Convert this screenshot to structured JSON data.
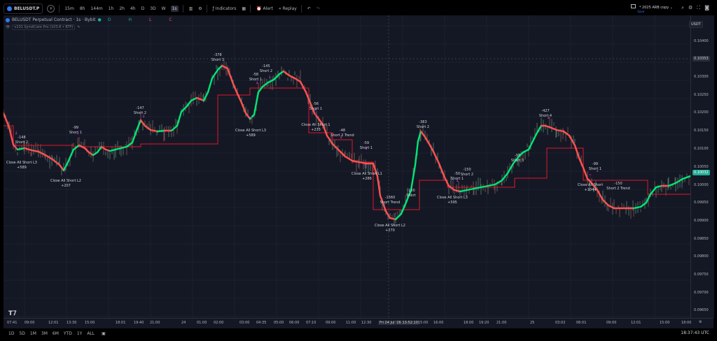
{
  "toolbar": {
    "symbol": "BELUSDT.P",
    "timeframes": [
      "15m",
      "8h",
      "144m",
      "1h",
      "2h",
      "4h",
      "D",
      "3D",
      "W",
      "1s"
    ],
    "active_timeframe": "1s",
    "indicators_label": "Indicators",
    "alert_label": "Alert",
    "replay_label": "Replay",
    "layout_name": "* 2025 ARB copy",
    "layout_status": "Save"
  },
  "legend": {
    "title": "BELUSDT Perpetual Contract · 1s · Bybit",
    "o_label": "O",
    "h_label": "H",
    "l_label": "L",
    "c_label": "C",
    "indicator": "v131 SyndiCate Pro (103.8 • RTF)"
  },
  "price_scale": {
    "currency": "USDT",
    "ticks": [
      "0.10400",
      "0.10350",
      "0.10300",
      "0.10250",
      "0.10200",
      "0.10150",
      "0.10100",
      "0.10050",
      "0.10000",
      "0.09950",
      "0.09900",
      "0.09850",
      "0.09800",
      "0.09750",
      "0.09700",
      "0.09650"
    ],
    "crosshair_price": "0.10353",
    "last_price": "0.10032"
  },
  "time_scale": {
    "ticks": [
      "07:41",
      "09:00",
      "12:01",
      "13:30",
      "15:00",
      "18:01",
      "19:40",
      "21:00",
      "24",
      "01:00",
      "02:00",
      "03:00",
      "04:35",
      "05:00",
      "06:00",
      "07:10",
      "09:00",
      "11:00",
      "12:30",
      "Fri 24 Jul '26  13:52:10",
      "15:00",
      "16:00",
      "18:00",
      "19:20",
      "21:00",
      "25",
      "03:02",
      "06:01",
      "09:00",
      "12:01",
      "15:00",
      "18:00"
    ],
    "highlight": "Fri 24 Jul '26  13:52:10"
  },
  "bottom": {
    "ranges": [
      "1D",
      "5D",
      "1M",
      "3M",
      "6M",
      "YTD",
      "1Y",
      "ALL"
    ],
    "clock": "18:37:43 UTC"
  },
  "annotations": [
    {
      "text": "-148",
      "sub": "Short 2"
    },
    {
      "text": "Close All Short L3",
      "sub": "+589"
    },
    {
      "text": "-99",
      "sub": "Short 1"
    },
    {
      "text": "Close All Short L2",
      "sub": "+207"
    },
    {
      "text": "-147",
      "sub": "Short 2"
    },
    {
      "text": "-378",
      "sub": "Short 3"
    },
    {
      "text": "-58",
      "sub": "Short 1"
    },
    {
      "text": "-145",
      "sub": "Short 2"
    },
    {
      "text": "Close All Short L3",
      "sub": "+589"
    },
    {
      "text": "-56",
      "sub": "Short 1"
    },
    {
      "text": "Close All Short 1",
      "sub": "+233"
    },
    {
      "text": "-48",
      "sub": "Short 2 Trend"
    },
    {
      "text": "-59",
      "sub": "Short 1"
    },
    {
      "text": "Close All Short L1",
      "sub": "+286"
    },
    {
      "text": "-1560",
      "sub": "Short Trend"
    },
    {
      "text": "-150",
      "sub": "Short"
    },
    {
      "text": "Close All Short L2",
      "sub": "+270"
    },
    {
      "text": "-383",
      "sub": "Short 2"
    },
    {
      "text": "-50",
      "sub": "Short 1"
    },
    {
      "text": "-150",
      "sub": "Short 2"
    },
    {
      "text": "Close All Short L3",
      "sub": "+595"
    },
    {
      "text": "-97",
      "sub": "Short 3"
    },
    {
      "text": "-427",
      "sub": "Short 4"
    },
    {
      "text": "-99",
      "sub": "Short 1"
    },
    {
      "text": "Close All Short",
      "sub": "+1044"
    },
    {
      "text": "-150",
      "sub": "Short 2 Trend"
    }
  ],
  "colors": {
    "background": "#141824",
    "up": "#00e676",
    "down": "#ff5252",
    "level": "#e0162b",
    "signal": "#9c27b0"
  }
}
